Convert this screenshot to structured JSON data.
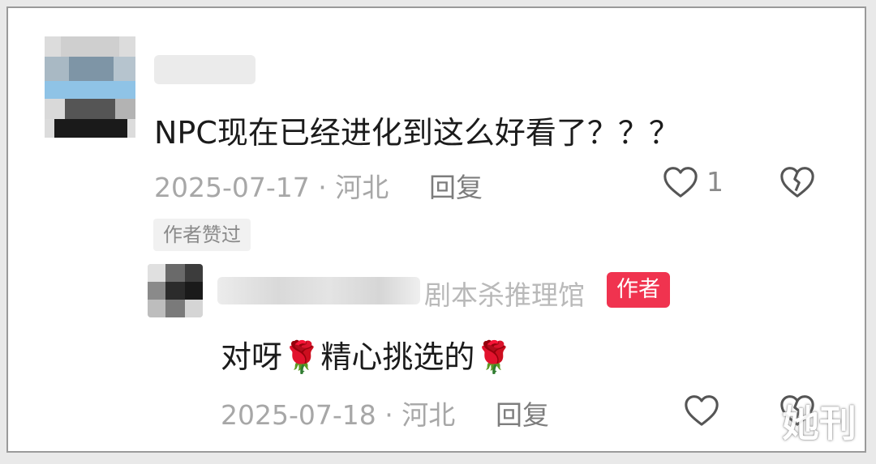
{
  "comment": {
    "text": "NPC现在已经进化到这么好看了？？？",
    "date": "2025-07-17",
    "separator": "·",
    "location": "河北",
    "reply_label": "回复",
    "like_count": "1",
    "liked_by_author_tag": "作者赞过"
  },
  "reply": {
    "author_name_suffix": "剧本杀推理馆",
    "author_badge": "作者",
    "text_part1": "对呀",
    "text_part2": "精心挑选的",
    "emoji": "🌹",
    "date": "2025-07-18",
    "separator": "·",
    "location": "河北",
    "reply_label": "回复"
  },
  "watermark": "她刊",
  "icons": {
    "like": "heart-outline-icon",
    "dislike": "broken-heart-icon",
    "emoji": "rose-icon"
  },
  "colors": {
    "badge": "#f0334f",
    "meta_text": "#a7a7a7",
    "body_text": "#1b1b1b"
  }
}
